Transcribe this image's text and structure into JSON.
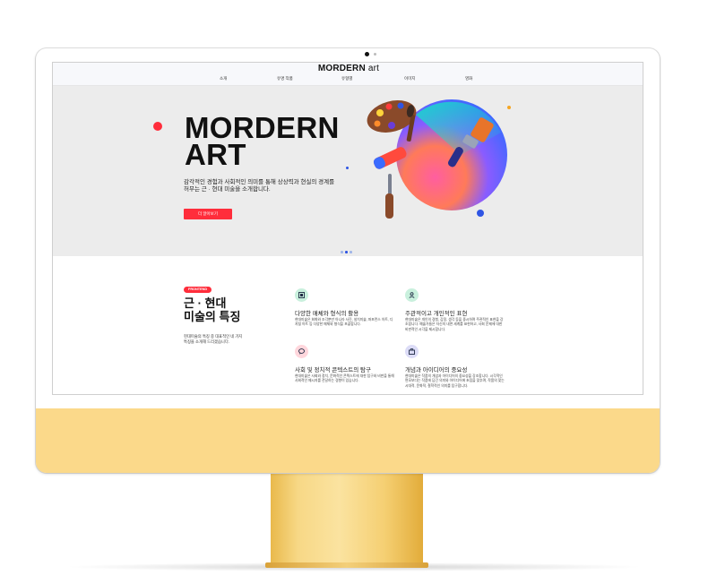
{
  "site": {
    "logo_bold": "MORDERN",
    "logo_light": " art"
  },
  "nav": {
    "items": [
      "소개",
      "유명 작품",
      "유형별",
      "이미지",
      "영화"
    ]
  },
  "hero": {
    "title_line1": "MORDERN",
    "title_line2": "ART",
    "description_line1": "감각적인 경험과 사회적인 의미를 통해 상상력과 현실의 경계를",
    "description_line2": "허무는 근 · 현대 미술을 소개합니다.",
    "button_label": "더 알아보기",
    "slide_count": 3,
    "active_slide": 2
  },
  "features": {
    "badge": "FRONTEND",
    "title_line1": "근 · 현대",
    "title_line2": "미술의 특징",
    "description_line1": "현대미술의 특징 중 대표적인 네 가지",
    "description_line2": "특징을 소개해 드리겠습니다.",
    "cards": [
      {
        "icon": "frame-icon",
        "title": "다양한 매체와 형식의 활용",
        "text": "현대미술은 회화와 조각뿐만 아니라 사진, 설치미술, 퍼포먼스 아트, 디지털 아트 등 다양한 매체와 형식을 포괄합니다."
      },
      {
        "icon": "person-icon",
        "title": "주관적이고 개인적인 표현",
        "text": "현대미술은 개인의 경험, 감정, 생각 등을 중시하며 주관적인 표현을 강조합니다. 예술가들은 자신의 내면 세계를 표현하고, 사회 문제에 대한 비판적인 시각을 제시합니다."
      },
      {
        "icon": "speech-bubble-icon",
        "title": "사회 및 정치적 콘텍스트의 탐구",
        "text": "현대미술은 사회와 정치, 문화적인 콘텍스트에 대한 탐구와 비판을 통해 사회적인 메시지를 전달하는 경향이 있습니다."
      },
      {
        "icon": "briefcase-icon",
        "title": "개념과 아이디어의 중요성",
        "text": "현대미술은 작품의 개념과 아이디어의 중요성을 강조합니다. 시각적인 면모보다는 작품에 담긴 의미와 아이디어에 초점을 맞추며, 작품의 맞는 시대적, 문화적, 철학적인 의미를 탐구합니다."
      }
    ]
  },
  "colors": {
    "accent": "#ff2d3b",
    "hero_bg": "#ececec",
    "chin": "#fbd98a",
    "header_bg": "#f7f8fb"
  }
}
